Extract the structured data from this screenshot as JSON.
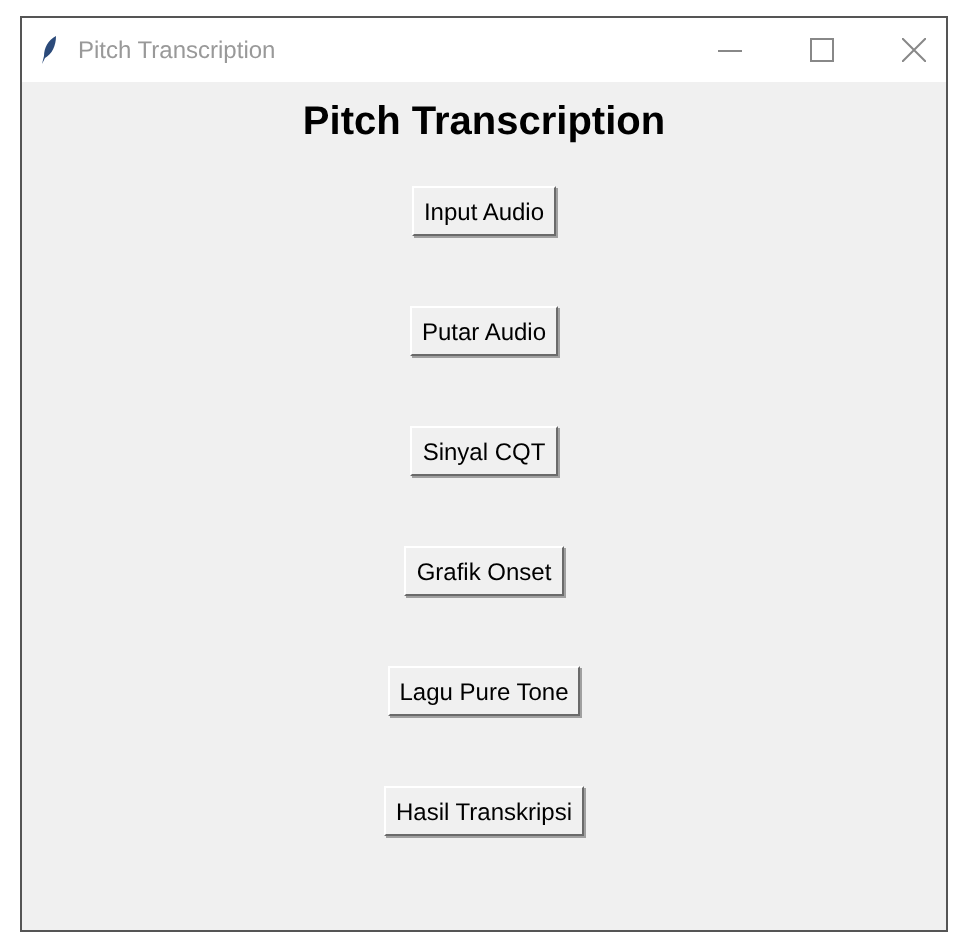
{
  "window": {
    "title": "Pitch Transcription"
  },
  "heading": "Pitch Transcription",
  "buttons": [
    "Input Audio",
    "Putar Audio",
    "Sinyal CQT",
    "Grafik Onset",
    "Lagu Pure Tone",
    "Hasil Transkripsi"
  ]
}
